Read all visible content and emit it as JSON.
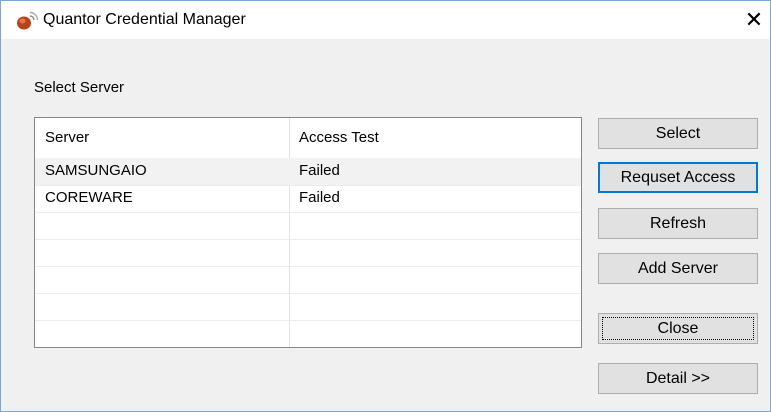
{
  "window": {
    "title": "Quantor Credential Manager",
    "close_glyph": "✕",
    "icon": "quantor-app-icon"
  },
  "group_label": "Select Server",
  "list": {
    "columns": [
      "Server",
      "Access Test"
    ],
    "rows": [
      {
        "server": "SAMSUNGAIO",
        "access_test": "Failed",
        "selected": true
      },
      {
        "server": "COREWARE",
        "access_test": "Failed",
        "selected": false
      }
    ]
  },
  "buttons": {
    "select": "Select",
    "request_access": "Requset Access",
    "refresh": "Refresh",
    "add_server": "Add Server",
    "close": "Close",
    "detail": "Detail >>"
  },
  "colors": {
    "window_border": "#7aa7d6",
    "default_button_border": "#0078d7",
    "dialog_background": "#f0f0f0"
  }
}
